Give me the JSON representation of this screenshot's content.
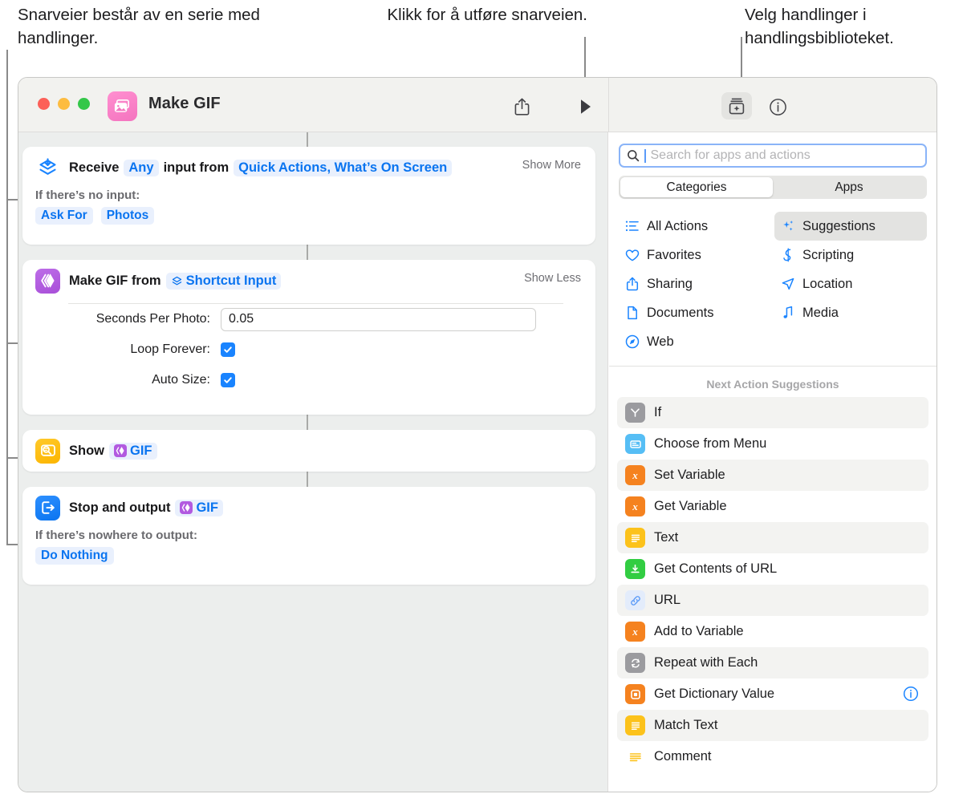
{
  "callouts": [
    {
      "id": "callout-left",
      "text": "Snarveier består av en serie med handlinger."
    },
    {
      "id": "callout-run",
      "text": "Klikk for å utføre snarveien."
    },
    {
      "id": "callout-library",
      "text": "Velg handlinger i handlingsbiblioteket."
    }
  ],
  "window": {
    "title": "Make GIF",
    "app_icon": "photos-icon",
    "traffic_lights": [
      "close-button",
      "minimize-button",
      "zoom-button"
    ],
    "toolbar": {
      "share_label": "share-icon",
      "play_label": "play-icon",
      "library_label": "action-library-icon",
      "info_label": "info-icon"
    }
  },
  "editor": {
    "actions": [
      {
        "icon": "receive-input-icon",
        "icon_color": "#1a84ff",
        "words": [
          "Receive",
          "input from"
        ],
        "token1": "Any",
        "token2": "Quick Actions, What’s On Screen",
        "toggle": "Show More",
        "sub_label": "If there’s no input:",
        "pills": [
          "Ask For",
          "Photos"
        ]
      },
      {
        "icon": "make-gif-icon",
        "icon_color": "#b25ae0",
        "title": "Make GIF from",
        "token": "Shortcut Input",
        "token_icon": "shortcut-input-icon",
        "toggle": "Show Less",
        "fields": [
          {
            "label": "Seconds Per Photo:",
            "type": "text",
            "value": "0.05"
          },
          {
            "label": "Loop Forever:",
            "type": "checkbox",
            "checked": true
          },
          {
            "label": "Auto Size:",
            "type": "checkbox",
            "checked": true
          }
        ]
      },
      {
        "icon": "quick-look-icon",
        "icon_color": "#ffc107",
        "title": "Show",
        "token": "GIF",
        "token_icon": "gif-variable-icon"
      },
      {
        "icon": "stop-and-output-icon",
        "icon_color": "#1a84ff",
        "title": "Stop and output",
        "token": "GIF",
        "token_icon": "gif-variable-icon",
        "sub_label": "If there’s nowhere to output:",
        "pills": [
          "Do Nothing"
        ]
      }
    ]
  },
  "library": {
    "search": {
      "placeholder": "Search for apps and actions",
      "value": ""
    },
    "segments": [
      {
        "label": "Categories",
        "active": true
      },
      {
        "label": "Apps",
        "active": false
      }
    ],
    "categories": [
      {
        "label": "All Actions",
        "icon": "list-icon",
        "active": false
      },
      {
        "label": "Suggestions",
        "icon": "sparkles-icon",
        "active": true
      },
      {
        "label": "Favorites",
        "icon": "heart-icon",
        "active": false
      },
      {
        "label": "Scripting",
        "icon": "scripting-icon",
        "active": false
      },
      {
        "label": "Sharing",
        "icon": "share-icon",
        "active": false
      },
      {
        "label": "Location",
        "icon": "location-arrow-icon",
        "active": false
      },
      {
        "label": "Documents",
        "icon": "document-icon",
        "active": false
      },
      {
        "label": "Media",
        "icon": "music-note-icon",
        "active": false
      },
      {
        "label": "Web",
        "icon": "safari-compass-icon",
        "active": false
      }
    ],
    "suggestions_title": "Next Action Suggestions",
    "suggestions": [
      {
        "label": "If",
        "icon": "if-icon",
        "color": "#9b9b9f",
        "alt": true,
        "info": false
      },
      {
        "label": "Choose from Menu",
        "icon": "menu-icon",
        "color": "#56bef5",
        "alt": false,
        "info": false
      },
      {
        "label": "Set Variable",
        "icon": "variable-icon",
        "color": "#f5821f",
        "alt": true,
        "info": false
      },
      {
        "label": "Get Variable",
        "icon": "variable-icon",
        "color": "#f5821f",
        "alt": false,
        "info": false
      },
      {
        "label": "Text",
        "icon": "text-icon",
        "color": "#fcc21b",
        "alt": true,
        "info": false
      },
      {
        "label": "Get Contents of URL",
        "icon": "download-icon",
        "color": "#32cd42",
        "alt": false,
        "info": false
      },
      {
        "label": "URL",
        "icon": "link-icon",
        "color": "#e3ecfb",
        "alt": true,
        "info": false
      },
      {
        "label": "Add to Variable",
        "icon": "variable-icon",
        "color": "#f5821f",
        "alt": false,
        "info": false
      },
      {
        "label": "Repeat with Each",
        "icon": "repeat-icon",
        "color": "#9b9b9f",
        "alt": true,
        "info": false
      },
      {
        "label": "Get Dictionary Value",
        "icon": "dictionary-icon",
        "color": "#f5821f",
        "alt": false,
        "info": true
      },
      {
        "label": "Match Text",
        "icon": "text-icon",
        "color": "#fcc21b",
        "alt": true,
        "info": false
      },
      {
        "label": "Comment",
        "icon": "comment-icon",
        "color": "#ffffff",
        "alt": false,
        "info": false
      }
    ]
  },
  "colors": {
    "accent_blue": "#0a74f0",
    "token_bg": "#e9f0fd",
    "pane_bg": "#eceeed",
    "titlebar_bg": "#f2f2ef"
  }
}
